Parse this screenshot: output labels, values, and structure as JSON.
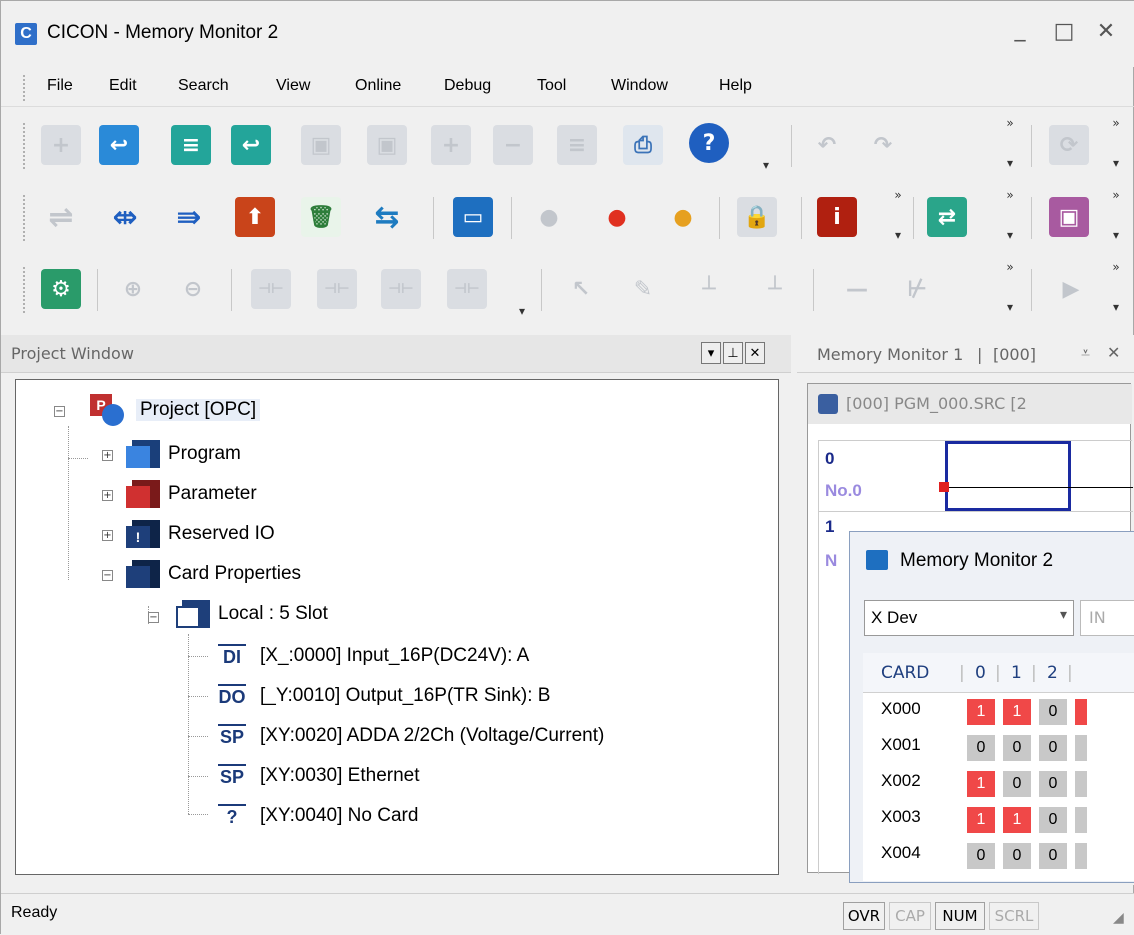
{
  "window": {
    "title": "CICON - Memory Monitor 2",
    "app_icon": "C",
    "minimize": "_",
    "maximize": "□",
    "close": "✕"
  },
  "menu": [
    "File",
    "Edit",
    "Search",
    "View",
    "Online",
    "Debug",
    "Tool",
    "Window",
    "Help"
  ],
  "toolbar": {
    "more_glyph": "»",
    "arrow_glyph": "▾"
  },
  "project_window": {
    "title": "Project Window",
    "root": "Project [OPC]",
    "nodes": [
      "Program",
      "Parameter",
      "Reserved IO",
      "Card Properties"
    ],
    "local": "Local : 5 Slot",
    "cards": [
      {
        "icon": "DI",
        "text": "[X_:0000] Input_16P(DC24V): A"
      },
      {
        "icon": "DO",
        "text": "[_Y:0010] Output_16P(TR Sink): B"
      },
      {
        "icon": "SP",
        "text": "[XY:0020] ADDA 2/2Ch (Voltage/Current)"
      },
      {
        "icon": "SP",
        "text": "[XY:0030] Ethernet"
      },
      {
        "icon": "?",
        "text": "[XY:0040] No Card"
      }
    ]
  },
  "memory_monitor_1": {
    "tab": "Memory Monitor 1",
    "tab_sep": "|",
    "tab_extra": "[000]",
    "doc_title": "[000] PGM_000.SRC [2",
    "rung0": "0",
    "rung0_label": "No.0",
    "rung1": "1",
    "rung1_label": "N"
  },
  "memory_monitor_2": {
    "title": "Memory Monitor 2",
    "device": "X Dev",
    "input_label": "IN",
    "headers": [
      "CARD",
      "0",
      "1",
      "2"
    ],
    "rows": [
      {
        "label": "X000",
        "bits": [
          "1",
          "1",
          "0"
        ]
      },
      {
        "label": "X001",
        "bits": [
          "0",
          "0",
          "0"
        ]
      },
      {
        "label": "X002",
        "bits": [
          "1",
          "0",
          "0"
        ]
      },
      {
        "label": "X003",
        "bits": [
          "1",
          "1",
          "0"
        ]
      },
      {
        "label": "X004",
        "bits": [
          "0",
          "0",
          "0"
        ]
      }
    ]
  },
  "status": {
    "text": "Ready",
    "indicators": [
      "OVR",
      "CAP",
      "NUM",
      "SCRL"
    ]
  }
}
